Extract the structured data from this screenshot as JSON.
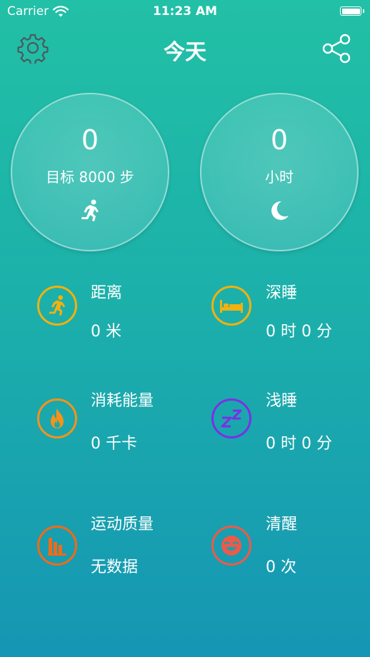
{
  "status_bar": {
    "carrier": "Carrier",
    "time": "11:23 AM"
  },
  "nav": {
    "title": "今天",
    "left_icon": "gear-icon",
    "right_icon": "share-icon"
  },
  "summary": {
    "steps": {
      "value": "0",
      "label": "目标 8000 步",
      "icon": "running-person-icon"
    },
    "sleep": {
      "value": "0",
      "label": "小时",
      "icon": "moon-icon"
    }
  },
  "stats": {
    "distance": {
      "label": "距离",
      "value": "0 米",
      "color": "#f2b10f",
      "icon": "running-person-icon"
    },
    "deep_sleep": {
      "label": "深睡",
      "value": "0 时 0 分",
      "color": "#f2b10f",
      "icon": "bed-icon"
    },
    "calories": {
      "label": "消耗能量",
      "value": "0 千卡",
      "color": "#f59319",
      "icon": "flame-icon"
    },
    "light_sleep": {
      "label": "浅睡",
      "value": "0 时 0 分",
      "color": "#7d2ee8",
      "icon": "zz-icon"
    },
    "exercise": {
      "label": "运动质量",
      "value": "无数据",
      "color": "#f26a16",
      "icon": "bar-chart-icon"
    },
    "awake": {
      "label": "清醒",
      "value": "0 次",
      "color": "#ee5a48",
      "icon": "face-icon"
    }
  }
}
